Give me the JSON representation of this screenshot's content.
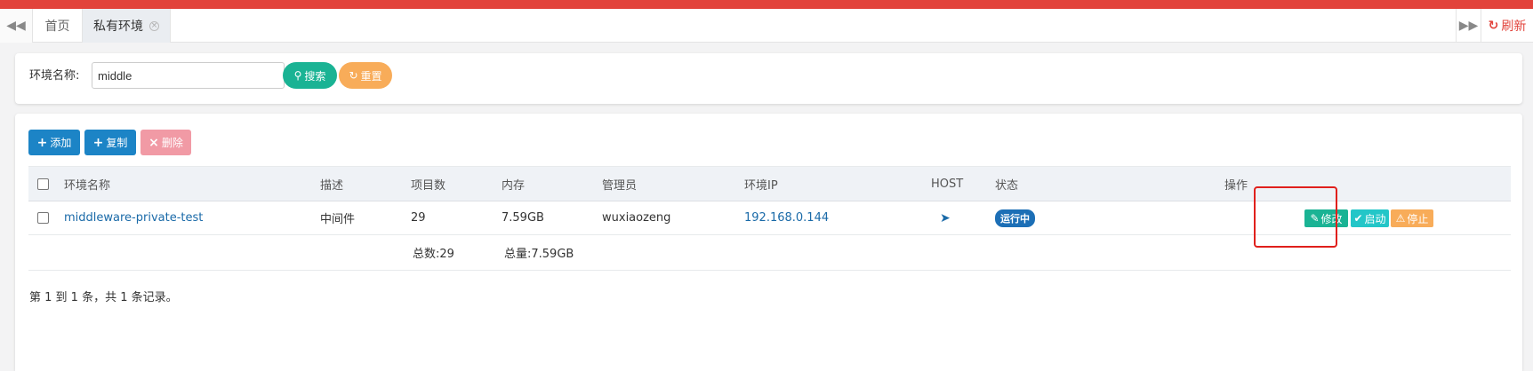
{
  "colors": {
    "top_strip": "#e2433b",
    "primary": "#1c84c6",
    "success": "#1ab394",
    "info": "#23c6c8",
    "warning": "#f8ac59",
    "danger_light": "#f19aa5",
    "badge_running": "#1c6fb6",
    "highlight_box": "#e0201c"
  },
  "tabs": {
    "nav_left_icon": "double-left-icon",
    "home_label": "首页",
    "active_label": "私有环境",
    "nav_right_icon": "double-right-icon",
    "refresh_label": "刷新"
  },
  "search": {
    "label": "环境名称:",
    "input_value": "middle",
    "search_button": "搜索",
    "reset_button": "重置"
  },
  "toolbar": {
    "add_label": "添加",
    "copy_label": "复制",
    "delete_label": "删除"
  },
  "table": {
    "columns": {
      "name": "环境名称",
      "desc": "描述",
      "project_count": "项目数",
      "memory": "内存",
      "admin": "管理员",
      "ip": "环境IP",
      "host": "HOST",
      "status": "状态",
      "actions": "操作"
    },
    "rows": [
      {
        "name": "middleware-private-test",
        "desc": "中间件",
        "project_count": "29",
        "memory": "7.59GB",
        "admin": "wuxiaozeng",
        "ip": "192.168.0.144",
        "host_icon": "paper-plane-icon",
        "status": "运行中",
        "actions": {
          "edit": "修改",
          "start": "启动",
          "stop": "停止"
        }
      }
    ],
    "footer": {
      "project_total": "总数:29",
      "memory_total": "总量:7.59GB"
    }
  },
  "pagination": {
    "info": "第 1 到 1 条，共 1 条记录。"
  }
}
